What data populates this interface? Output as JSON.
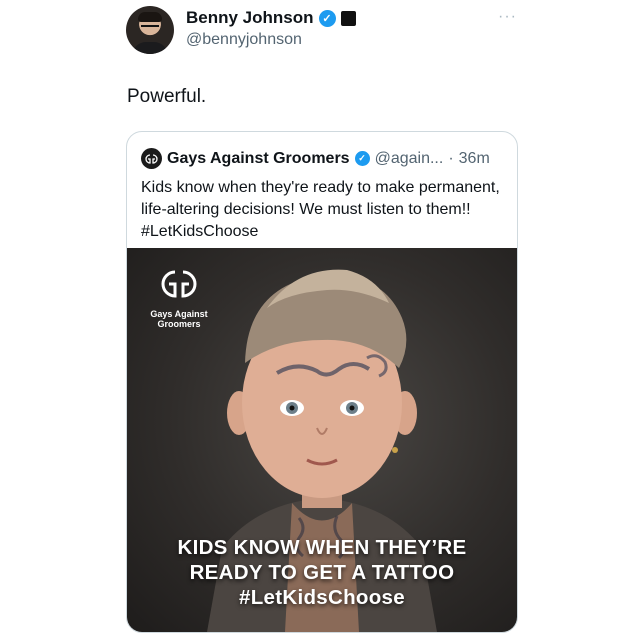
{
  "author": {
    "display_name": "Benny Johnson",
    "handle": "@bennyjohnson",
    "verified_icon": "verified-check-icon",
    "affiliation_icon": "affiliation-badge-icon"
  },
  "more_icon": "more-icon",
  "text": "Powerful.",
  "quoted_tweet": {
    "display_name": "Gays Against Groomers",
    "handle": "@again...",
    "separator": "·",
    "time": "36m",
    "text": "Kids know when they're ready to make permanent, life-altering decisions! We must listen to them!! #LetKidsChoose",
    "image": {
      "logo_text": "Gays Against Groomers",
      "caption_lines": [
        "KIDS KNOW WHEN THEY’RE",
        "READY TO GET A TATTOO",
        "#LetKidsChoose"
      ]
    }
  },
  "colors": {
    "verified": "#1d9bf0",
    "text_primary": "#0f1419",
    "text_secondary": "#536471",
    "border": "#cfd9de"
  }
}
